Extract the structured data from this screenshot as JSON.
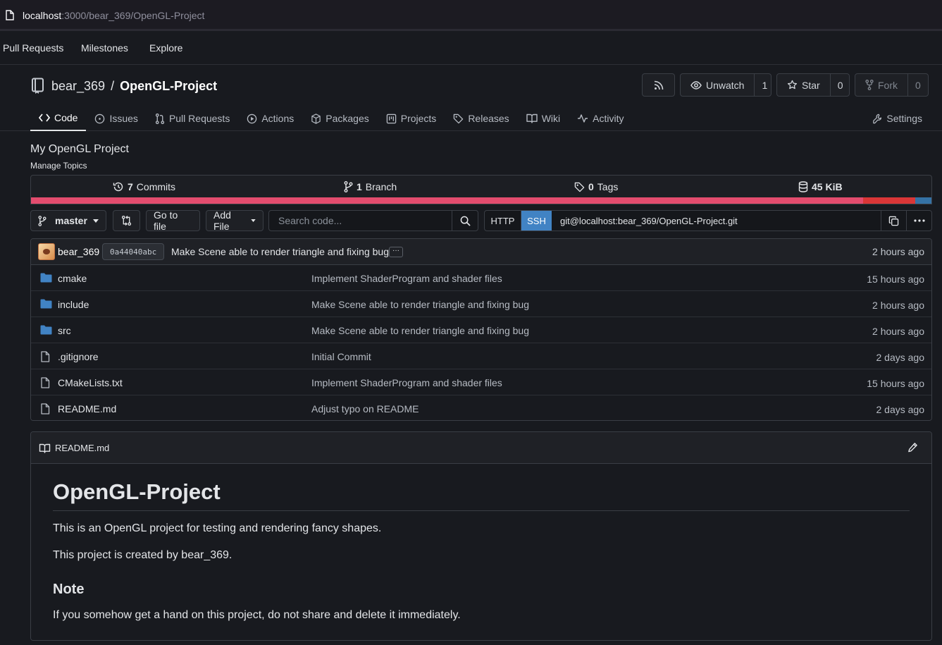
{
  "browser": {
    "url_host": "localhost",
    "url_rest": ":3000/bear_369/OpenGL-Project"
  },
  "topnav": {
    "items": [
      "Pull Requests",
      "Milestones",
      "Explore"
    ]
  },
  "repo": {
    "owner": "bear_369",
    "separator": "/",
    "name": "OpenGL-Project",
    "unwatch_label": "Unwatch",
    "watch_count": "1",
    "star_label": "Star",
    "star_count": "0",
    "fork_label": "Fork",
    "fork_count": "0"
  },
  "tabs": [
    {
      "label": "Code",
      "icon": "code-icon"
    },
    {
      "label": "Issues",
      "icon": "issue-icon"
    },
    {
      "label": "Pull Requests",
      "icon": "pull-request-icon"
    },
    {
      "label": "Actions",
      "icon": "play-icon"
    },
    {
      "label": "Packages",
      "icon": "package-icon"
    },
    {
      "label": "Projects",
      "icon": "project-icon"
    },
    {
      "label": "Releases",
      "icon": "tag-icon"
    },
    {
      "label": "Wiki",
      "icon": "book-icon"
    },
    {
      "label": "Activity",
      "icon": "pulse-icon"
    }
  ],
  "settings_label": "Settings",
  "description": "My OpenGL Project",
  "manage_topics": "Manage Topics",
  "stats": {
    "commits_count": "7",
    "commits_label": "Commits",
    "branches_count": "1",
    "branches_label": "Branch",
    "tags_count": "0",
    "tags_label": "Tags",
    "size": "45 KiB"
  },
  "language_colors": [
    "#e34c6e",
    "#da3637",
    "#3572a5"
  ],
  "toolbar": {
    "branch": "master",
    "go_to_file": "Go to file",
    "add_file": "Add File",
    "search_placeholder": "Search code...",
    "http_label": "HTTP",
    "ssh_label": "SSH",
    "clone_url": "git@localhost:bear_369/OpenGL-Project.git"
  },
  "latest_commit": {
    "author": "bear_369",
    "sha": "0a44040abc",
    "message": "Make Scene able to render triangle and fixing bug",
    "time": "2 hours ago"
  },
  "files": [
    {
      "name": "cmake",
      "type": "folder",
      "message": "Implement ShaderProgram and shader files",
      "time": "15 hours ago"
    },
    {
      "name": "include",
      "type": "folder",
      "message": "Make Scene able to render triangle and fixing bug",
      "time": "2 hours ago"
    },
    {
      "name": "src",
      "type": "folder",
      "message": "Make Scene able to render triangle and fixing bug",
      "time": "2 hours ago"
    },
    {
      "name": ".gitignore",
      "type": "file",
      "message": "Initial Commit",
      "time": "2 days ago"
    },
    {
      "name": "CMakeLists.txt",
      "type": "file",
      "message": "Implement ShaderProgram and shader files",
      "time": "15 hours ago"
    },
    {
      "name": "README.md",
      "type": "file",
      "message": "Adjust typo on README",
      "time": "2 days ago"
    }
  ],
  "readme": {
    "filename": "README.md",
    "h1": "OpenGL-Project",
    "p1": "This is an OpenGL project for testing and rendering fancy shapes.",
    "p2": "This project is created by bear_369.",
    "h2": "Note",
    "p3": "If you somehow get a hand on this project, do not share and delete it immediately."
  },
  "accent_color": "#4183c4"
}
